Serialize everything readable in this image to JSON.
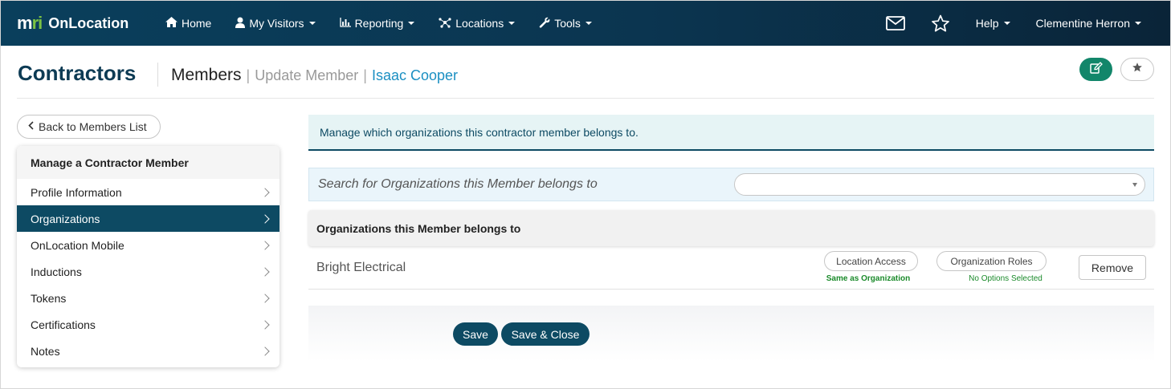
{
  "brand": {
    "logo_left": "m",
    "logo_accent": "ri",
    "name": "OnLocation"
  },
  "nav": {
    "items": [
      {
        "label": "Home",
        "icon": "home-icon"
      },
      {
        "label": "My Visitors",
        "icon": "user-icon"
      },
      {
        "label": "Reporting",
        "icon": "chart-icon"
      },
      {
        "label": "Locations",
        "icon": "network-icon"
      },
      {
        "label": "Tools",
        "icon": "wrench-icon"
      }
    ],
    "help_label": "Help",
    "user_name": "Clementine Herron"
  },
  "header": {
    "title": "Contractors",
    "crumb_section": "Members",
    "crumb_action": "Update Member",
    "crumb_member": "Isaac Cooper"
  },
  "sidebar": {
    "back_label": "Back to Members List",
    "heading": "Manage a Contractor Member",
    "items": [
      {
        "label": "Profile Information",
        "active": false
      },
      {
        "label": "Organizations",
        "active": true
      },
      {
        "label": "OnLocation Mobile",
        "active": false
      },
      {
        "label": "Inductions",
        "active": false
      },
      {
        "label": "Tokens",
        "active": false
      },
      {
        "label": "Certifications",
        "active": false
      },
      {
        "label": "Notes",
        "active": false
      }
    ]
  },
  "main": {
    "info_text": "Manage which organizations this contractor member belongs to.",
    "search_label": "Search for Organizations this Member belongs to",
    "search_value": "",
    "panel_title": "Organizations this Member belongs to",
    "organizations": [
      {
        "name": "Bright Electrical",
        "location_access_label": "Location Access",
        "location_access_status": "Same as Organization",
        "roles_label": "Organization Roles",
        "roles_status": "No Options Selected",
        "remove_label": "Remove"
      }
    ],
    "save_label": "Save",
    "save_close_label": "Save & Close"
  },
  "colors": {
    "navbar": "#0b3550",
    "primary": "#0d4a63",
    "link": "#1b8fc2",
    "edit_button": "#12866a",
    "status_green": "#1a8a2a",
    "info_bg": "#e6f4f5"
  }
}
